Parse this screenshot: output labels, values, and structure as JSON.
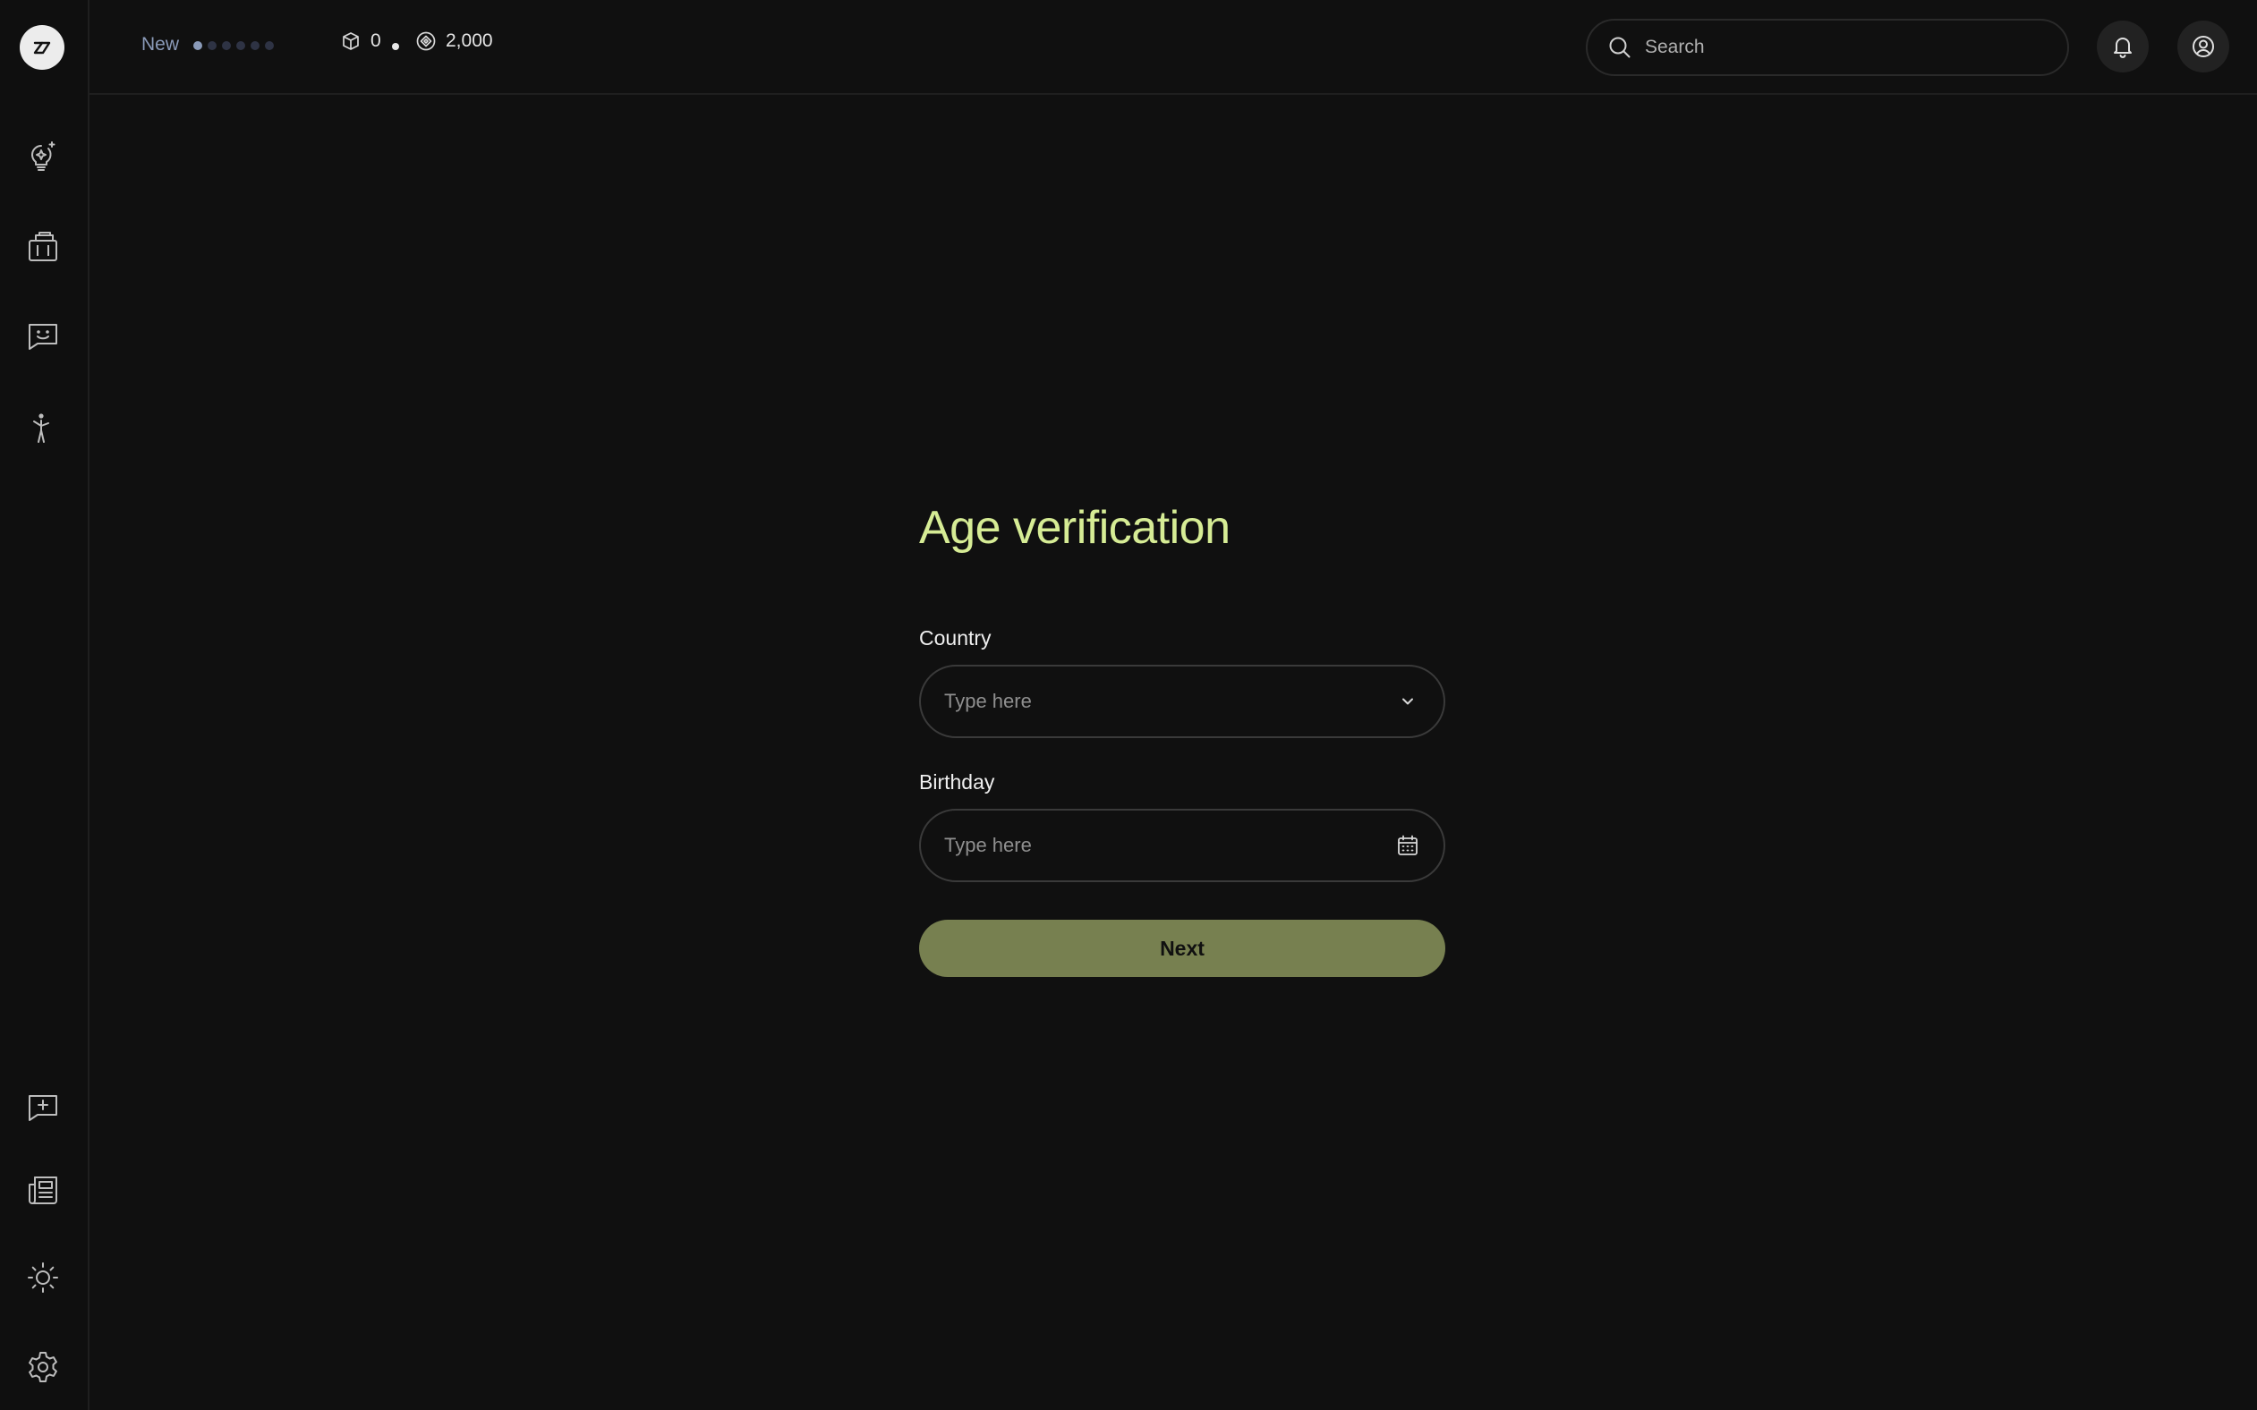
{
  "sidebar": {
    "logo_text": "z",
    "top_items": [
      {
        "name": "ideas",
        "icon": "lightbulb-sparkle-icon"
      },
      {
        "name": "library",
        "icon": "cards-stack-icon"
      },
      {
        "name": "chat",
        "icon": "chat-smile-icon"
      },
      {
        "name": "activity",
        "icon": "person-reaching-icon"
      }
    ],
    "bottom_items": [
      {
        "name": "new-chat",
        "icon": "chat-plus-icon"
      },
      {
        "name": "news",
        "icon": "newspaper-icon"
      },
      {
        "name": "theme",
        "icon": "sun-icon"
      },
      {
        "name": "settings",
        "icon": "gear-icon"
      }
    ]
  },
  "topbar": {
    "status_label": "New",
    "progress_dots_total": 6,
    "progress_dots_filled": 1,
    "stat_box_value": "0",
    "stat_credits_value": "2,000",
    "search_placeholder": "Search",
    "search_value": ""
  },
  "form": {
    "title": "Age verification",
    "country_label": "Country",
    "country_placeholder": "Type here",
    "country_value": "",
    "birthday_label": "Birthday",
    "birthday_placeholder": "Type here",
    "birthday_value": "",
    "next_label": "Next"
  },
  "colors": {
    "background": "#101010",
    "accent_title": "#d6ec95",
    "button_bg": "#778050",
    "status_text": "#8a9ab8"
  }
}
